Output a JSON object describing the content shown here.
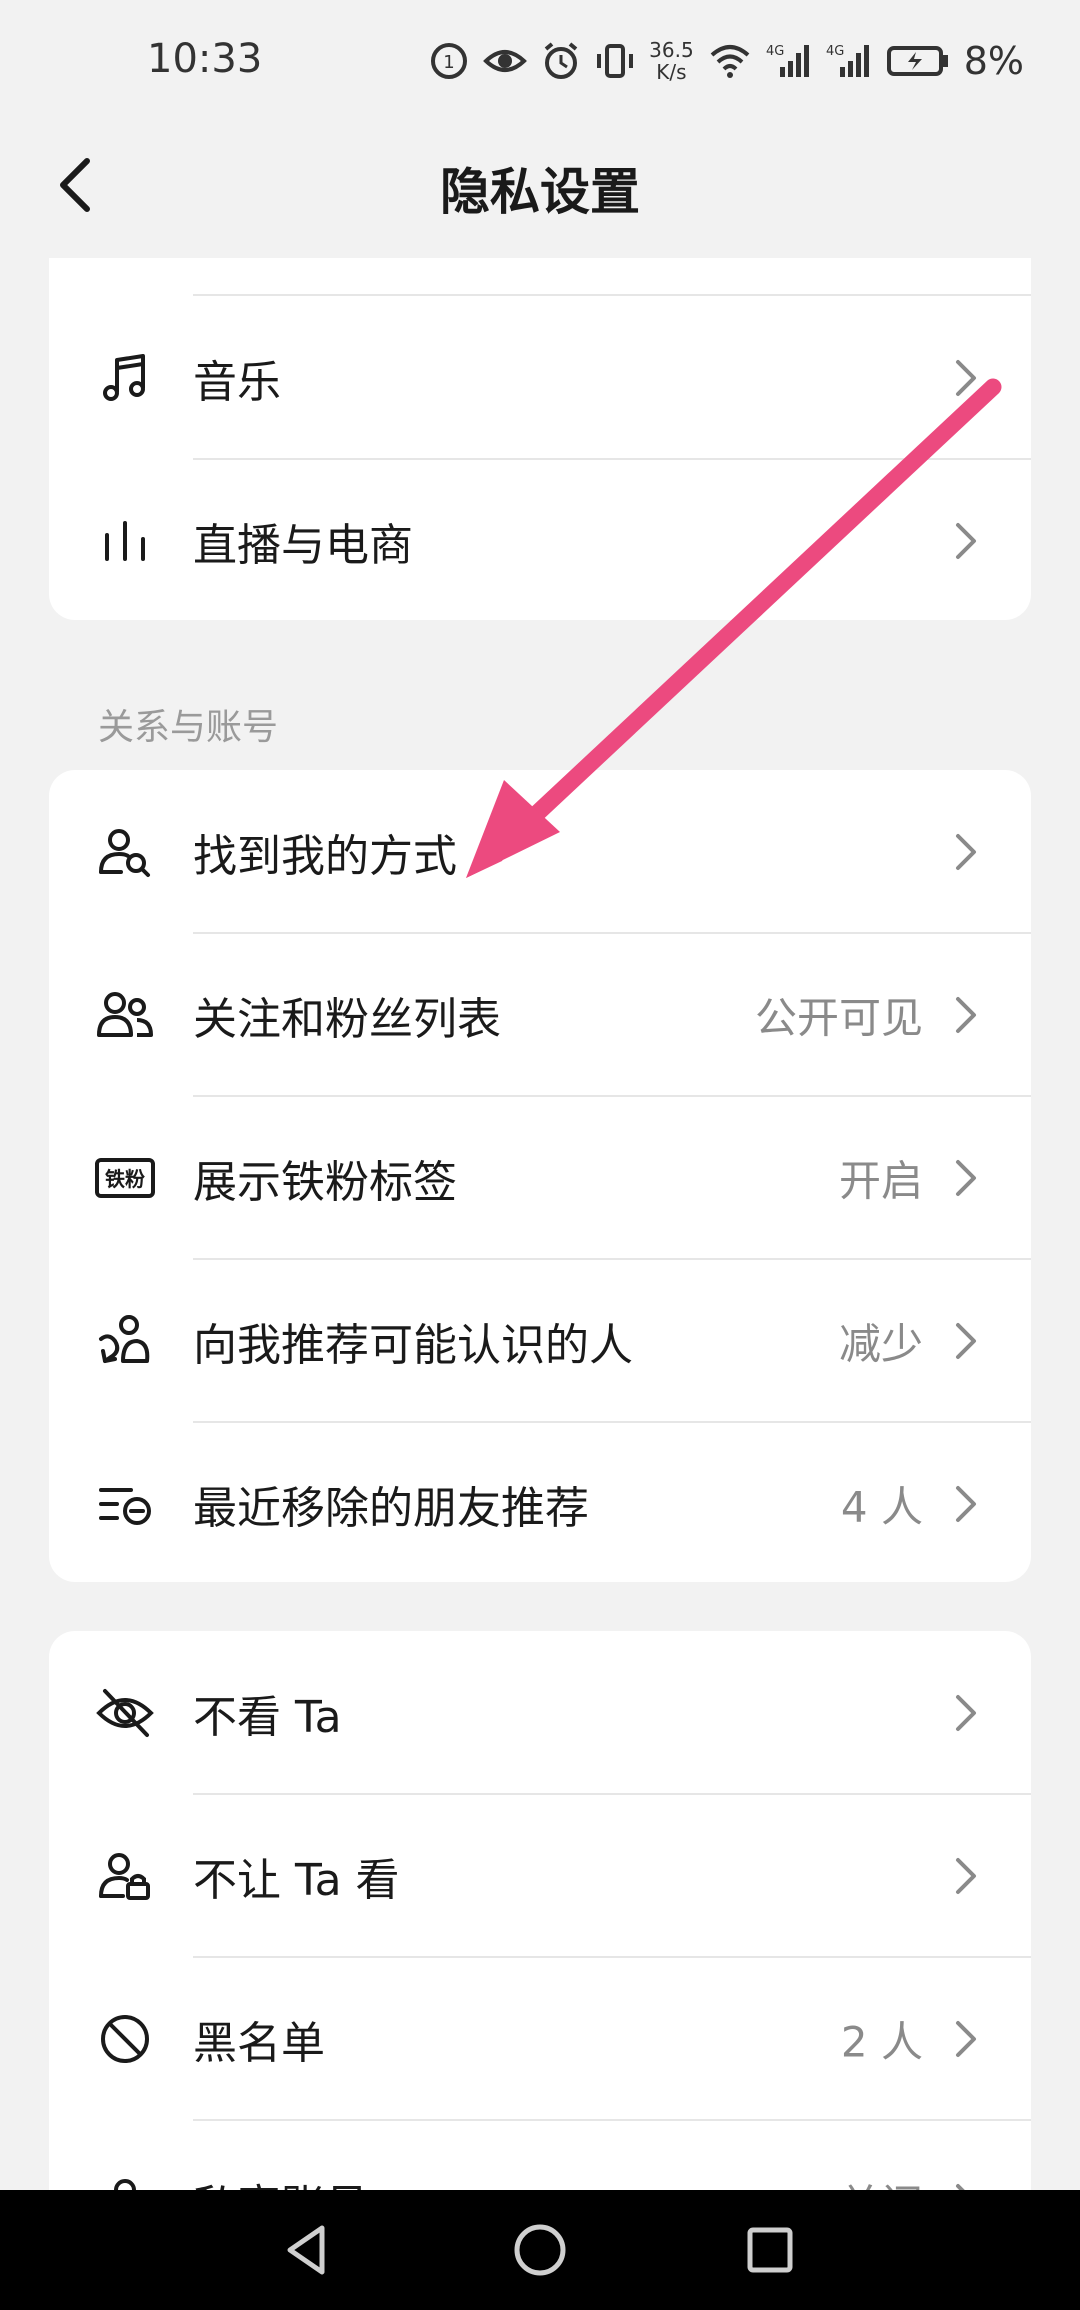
{
  "status_bar": {
    "time": "10:33",
    "speed_value": "36.5",
    "speed_unit": "K/s",
    "network_1": "4G",
    "network_2": "4G",
    "battery": "8%"
  },
  "nav": {
    "title": "隐私设置"
  },
  "card_top": {
    "items": [
      {
        "label": "音乐",
        "icon": "music-note-icon"
      },
      {
        "label": "直播与电商",
        "icon": "live-bars-icon"
      }
    ]
  },
  "section_relations": {
    "title": "关系与账号"
  },
  "card_relations": {
    "items": [
      {
        "label": "找到我的方式",
        "value": "",
        "icon": "person-search-icon"
      },
      {
        "label": "关注和粉丝列表",
        "value": "公开可见",
        "icon": "people-icon"
      },
      {
        "label": "展示铁粉标签",
        "value": "开启",
        "icon": "fan-badge-icon",
        "badge_text": "铁粉"
      },
      {
        "label": "向我推荐可能认识的人",
        "value": "减少",
        "icon": "person-link-icon"
      },
      {
        "label": "最近移除的朋友推荐",
        "value": "4 人",
        "icon": "list-remove-icon"
      }
    ]
  },
  "card_block": {
    "items": [
      {
        "label": "不看 Ta",
        "value": "",
        "icon": "eye-off-icon"
      },
      {
        "label": "不让 Ta 看",
        "value": "",
        "icon": "person-lock-icon"
      },
      {
        "label": "黑名单",
        "value": "2 人",
        "icon": "block-icon"
      },
      {
        "label": "私密账号",
        "value": "关闭",
        "icon": "private-account-icon"
      }
    ]
  },
  "colors": {
    "background": "#f2f2f2",
    "card": "#ffffff",
    "annotation_arrow": "#ec4a7f",
    "secondary_text": "#8a8a8a"
  }
}
